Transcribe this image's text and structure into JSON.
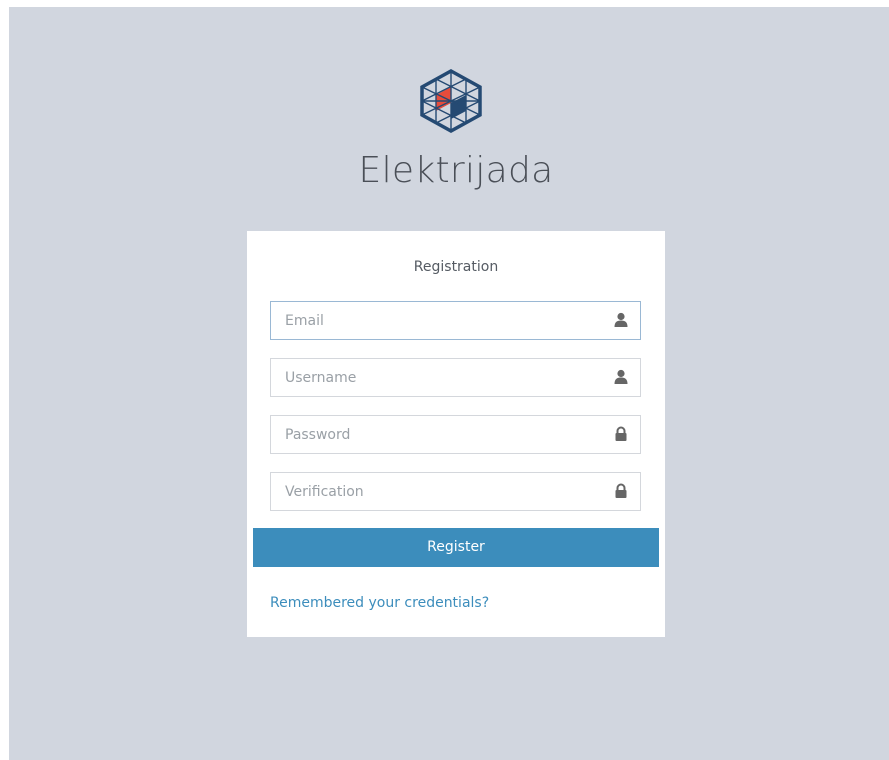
{
  "brand": {
    "name": "Elektrijada",
    "logo_icon": "elektrijada-hexagon-logo",
    "logo_colors": {
      "primary": "#254a73",
      "accent": "#e74c3c"
    }
  },
  "form": {
    "title": "Registration",
    "fields": [
      {
        "placeholder": "Email",
        "value": "",
        "icon": "user-icon"
      },
      {
        "placeholder": "Username",
        "value": "",
        "icon": "user-icon"
      },
      {
        "placeholder": "Password",
        "value": "",
        "icon": "lock-icon"
      },
      {
        "placeholder": "Verification",
        "value": "",
        "icon": "lock-icon"
      }
    ],
    "submit_label": "Register",
    "credentials_link": "Remembered your credentials?"
  },
  "colors": {
    "page_background": "#d1d6df",
    "card_background": "#ffffff",
    "primary_button": "#3c8dbc",
    "link": "#3c8dbc",
    "icon": "#666666"
  }
}
